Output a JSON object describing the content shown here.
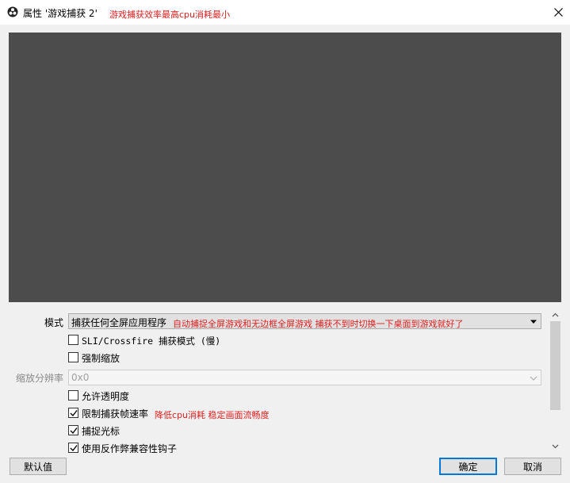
{
  "window": {
    "title": "属性 '游戏捕获 2'",
    "title_note": "游戏捕获效率最高cpu消耗最小",
    "app_icon": "obs-logo-icon",
    "close_icon": "close-icon"
  },
  "colors": {
    "preview_bg": "#4c4c4c",
    "note_red": "#e02020",
    "accent_blue": "#0078d7"
  },
  "properties": {
    "mode": {
      "label": "模式",
      "value": "捕获任何全屏应用程序",
      "note": "自动捕捉全屏游戏和无边框全屏游戏 捕获不到时切换一下桌面到游戏就好了"
    },
    "sli_crossfire": {
      "label": "SLI/Crossfire 捕获模式 (慢)",
      "checked": false
    },
    "force_scaling": {
      "label": "强制缩放",
      "checked": false
    },
    "scale_resolution": {
      "label": "缩放分辨率",
      "value": "0x0",
      "disabled": true
    },
    "allow_transparency": {
      "label": "允许透明度",
      "checked": false
    },
    "limit_framerate": {
      "label": "限制捕获帧速率",
      "checked": true,
      "note": "降低cpu消耗 稳定画面流畅度"
    },
    "capture_cursor": {
      "label": "捕捉光标",
      "checked": true
    },
    "anti_cheat_hook": {
      "label": "使用反作弊兼容性钩子",
      "checked": true
    }
  },
  "buttons": {
    "defaults": "默认值",
    "ok": "确定",
    "cancel": "取消"
  }
}
